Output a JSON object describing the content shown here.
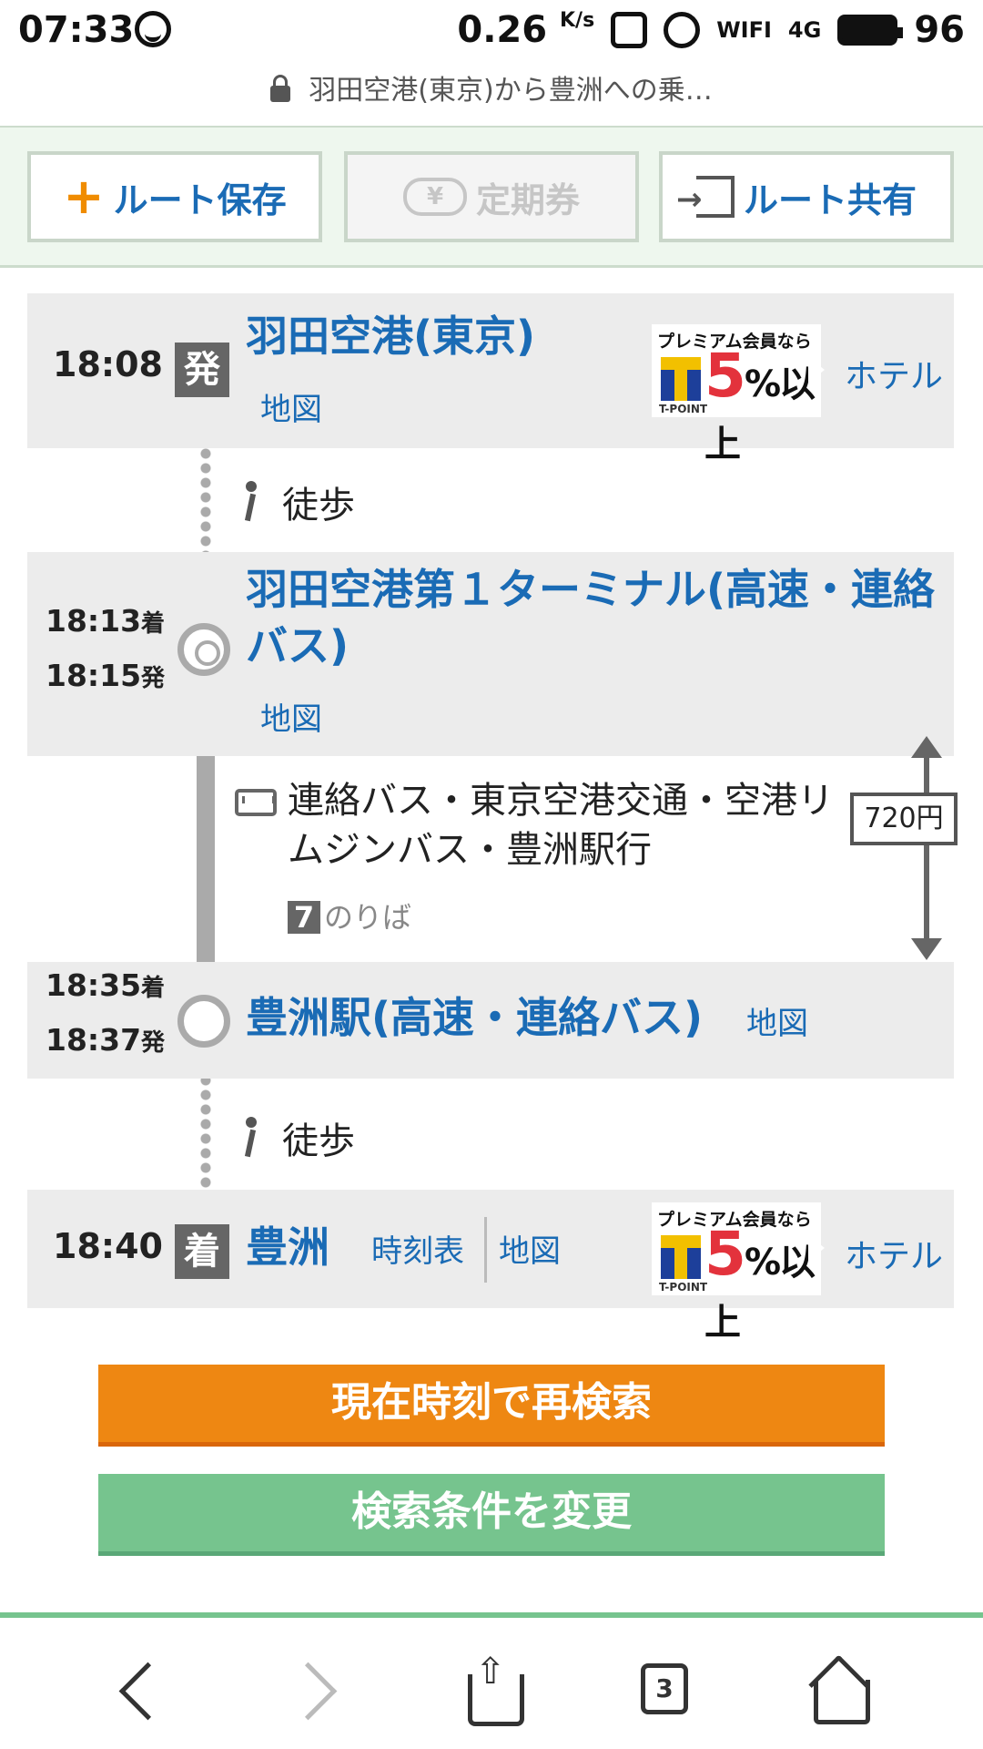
{
  "status_bar": {
    "time": "07:33",
    "net_speed": "0.26",
    "net_speed_unit": "K/s",
    "wifi_label": "WIFI",
    "signal_label": "4G",
    "battery": "96"
  },
  "url_bar": {
    "title": "羽田空港(東京)から豊洲への乗…"
  },
  "toolbar": {
    "save_label": "ルート保存",
    "commuter_label": "定期券",
    "share_label": "ルート共有"
  },
  "route": {
    "departure": {
      "time": "18:08",
      "badge": "発",
      "name": "羽田空港(東京)",
      "map_label": "地図",
      "ad_title": "プレミアム会員なら",
      "ad_value": "5",
      "ad_unit": "%以上",
      "ad_brand": "T-POINT",
      "hotel_label": "ホテル"
    },
    "walk1": "徒歩",
    "stop1": {
      "arrive_time": "18:13",
      "arrive_suffix": "着",
      "depart_time": "18:15",
      "depart_suffix": "発",
      "name": "羽田空港第１ターミナル(高速・連絡バス)",
      "map_label": "地図"
    },
    "bus": {
      "line": "連絡バス・東京空港交通・空港リムジンバス・豊洲駅行",
      "platform_num": "7",
      "platform_label": "のりば",
      "fare": "720円"
    },
    "stop2": {
      "arrive_time": "18:35",
      "arrive_suffix": "着",
      "depart_time": "18:37",
      "depart_suffix": "発",
      "name": "豊洲駅(高速・連絡バス)",
      "map_label": "地図"
    },
    "walk2": "徒歩",
    "arrival": {
      "time": "18:40",
      "badge": "着",
      "name": "豊洲",
      "timetable_label": "時刻表",
      "map_label": "地図",
      "ad_title": "プレミアム会員なら",
      "ad_value": "5",
      "ad_unit": "%以上",
      "ad_brand": "T-POINT",
      "hotel_label": "ホテル"
    }
  },
  "actions": {
    "research_label": "現在時刻で再検索",
    "change_label": "検索条件を変更"
  },
  "nav": {
    "tab_count": "3"
  },
  "colors": {
    "accent_blue": "#1a6bb5",
    "orange": "#ee8712",
    "green": "#76c48e"
  }
}
